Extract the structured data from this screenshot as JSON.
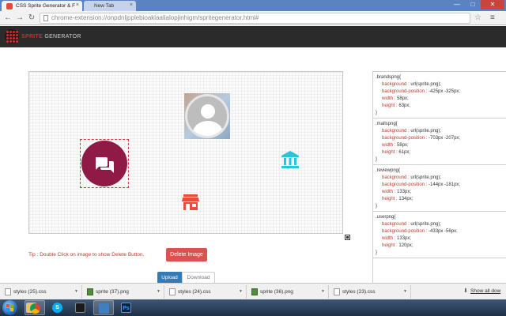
{
  "browser": {
    "tabs": [
      {
        "label": "CSS Sprite Generator & F",
        "active": true
      },
      {
        "label": "New Tab",
        "active": false
      }
    ],
    "address": "chrome-extension://onpdnljpplebioaklaalialopjinhigm/spritegenerator.html#",
    "window_controls": {
      "minimize": "—",
      "maximize": "□",
      "close": "✕"
    }
  },
  "app": {
    "logo_sprite": "SPRITE",
    "logo_generator": " GENERATOR"
  },
  "canvas": {
    "sprites": [
      {
        "name": "user-avatar-sprite",
        "icon": "user-icon"
      },
      {
        "name": "review-sprite",
        "icon": "chat-bubbles-icon",
        "color": "#8e1a45"
      },
      {
        "name": "brands-sprite",
        "icon": "bank-icon",
        "color": "#26c6da"
      },
      {
        "name": "malls-sprite",
        "icon": "store-icon",
        "color": "#e84c3d"
      }
    ]
  },
  "tip": "Tip : Double Click on image to show Delete Button.",
  "buttons": {
    "delete": "Delete Image",
    "upload": "Upload",
    "download": "Download"
  },
  "css_blocks": [
    {
      "selector": ".brandspng{",
      "bg": "url(sprite.png);",
      "pos": "-425px -325px;",
      "width": "58px;",
      "height": "63px;"
    },
    {
      "selector": ".mallspng{",
      "bg": "url(sprite.png);",
      "pos": "-703px -207px;",
      "width": "58px;",
      "height": "61px;"
    },
    {
      "selector": ".reviewpng{",
      "bg": "url(sprite.png);",
      "pos": "-144px -181px;",
      "width": "133px;",
      "height": "134px;"
    },
    {
      "selector": ".userpng{",
      "bg": "url(sprite.png);",
      "pos": "-433px -56px;",
      "width": "133px;",
      "height": "120px;"
    }
  ],
  "css_labels": {
    "bg": "background : ",
    "pos": "background-position : ",
    "width": "width : ",
    "height": "height : ",
    "close": "}"
  },
  "downloads": [
    {
      "file": "styles (25).css",
      "type": "css"
    },
    {
      "file": "sprite (37).png",
      "type": "png"
    },
    {
      "file": "styles (24).css",
      "type": "css"
    },
    {
      "file": "sprite (36).png",
      "type": "png"
    },
    {
      "file": "styles (23).css",
      "type": "css"
    }
  ],
  "show_all": "Show all dow",
  "taskbar": [
    {
      "name": "explorer",
      "label": ""
    },
    {
      "name": "chrome",
      "label": ""
    },
    {
      "name": "skype",
      "label": "S"
    },
    {
      "name": "terminal",
      "label": ""
    },
    {
      "name": "photos",
      "label": ""
    },
    {
      "name": "photoshop",
      "label": "Ps"
    }
  ]
}
